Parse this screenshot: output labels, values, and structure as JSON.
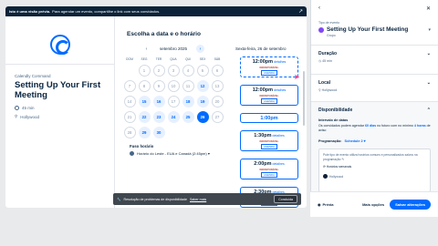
{
  "banner": {
    "bold": "Isto é uma visão prévia.",
    "text": "Para agendar um evento, compartilhe o link com seus convidados.",
    "icon": "external-link-icon"
  },
  "event": {
    "organizer": "Calendly Command",
    "title": "Setting Up Your First Meeting",
    "duration": "45 min",
    "location": "Hollywood"
  },
  "calendar": {
    "heading": "Escolha a data e o horário",
    "month": "setembro 2025",
    "dow": [
      "DOM",
      "SEG",
      "TER",
      "QUA",
      "QUI",
      "SEX",
      "SÁB"
    ],
    "weeks": [
      [
        {
          "d": "",
          "s": "blank"
        },
        {
          "d": "1",
          "s": ""
        },
        {
          "d": "2",
          "s": ""
        },
        {
          "d": "3",
          "s": ""
        },
        {
          "d": "4",
          "s": ""
        },
        {
          "d": "5",
          "s": ""
        },
        {
          "d": "6",
          "s": ""
        }
      ],
      [
        {
          "d": "7",
          "s": ""
        },
        {
          "d": "8",
          "s": ""
        },
        {
          "d": "9",
          "s": ""
        },
        {
          "d": "10",
          "s": ""
        },
        {
          "d": "11",
          "s": ""
        },
        {
          "d": "12",
          "s": "avail"
        },
        {
          "d": "13",
          "s": ""
        }
      ],
      [
        {
          "d": "14",
          "s": ""
        },
        {
          "d": "15",
          "s": "avail"
        },
        {
          "d": "16",
          "s": "avail"
        },
        {
          "d": "17",
          "s": ""
        },
        {
          "d": "18",
          "s": "avail"
        },
        {
          "d": "19",
          "s": "avail"
        },
        {
          "d": "20",
          "s": ""
        }
      ],
      [
        {
          "d": "21",
          "s": ""
        },
        {
          "d": "22",
          "s": "avail"
        },
        {
          "d": "23",
          "s": "avail"
        },
        {
          "d": "24",
          "s": "avail"
        },
        {
          "d": "25",
          "s": "avail"
        },
        {
          "d": "26",
          "s": "sel"
        },
        {
          "d": "27",
          "s": ""
        }
      ],
      [
        {
          "d": "28",
          "s": ""
        },
        {
          "d": "29",
          "s": "avail"
        },
        {
          "d": "30",
          "s": "avail"
        },
        {
          "d": "",
          "s": "blank"
        },
        {
          "d": "",
          "s": "blank"
        },
        {
          "d": "",
          "s": "blank"
        },
        {
          "d": "",
          "s": "blank"
        }
      ]
    ],
    "tz_label": "Fuso horário",
    "tz_value": "Horário do Leste - EUA e Canadá (2:45pm) ▾"
  },
  "times": {
    "date": "Sexta-feira, 26 de setembro",
    "slots": [
      {
        "time": "12:00pm",
        "detail": "detalhes",
        "flag": "INDISPONÍVEL",
        "badge": "AGENDA",
        "kind": "dashed"
      },
      {
        "time": "12:00pm",
        "detail": "detalhes",
        "flag": "INDISPONÍVEL",
        "badge": "AGENDA",
        "kind": ""
      },
      {
        "time": "1:00pm",
        "detail": "",
        "flag": "",
        "badge": "",
        "kind": "simple"
      },
      {
        "time": "1:30pm",
        "detail": "detalhes",
        "flag": "INDISPONÍVEL",
        "badge": "AGENDA",
        "kind": ""
      },
      {
        "time": "2:00pm",
        "detail": "detalhes",
        "flag": "INDISPONÍVEL",
        "badge": "AGENDA",
        "kind": ""
      },
      {
        "time": "2:30pm",
        "detail": "detalhes",
        "flag": "INDISPONÍVEL",
        "badge": "AGENDA",
        "kind": ""
      }
    ]
  },
  "notice": {
    "text": "Resolução de problemas de disponibilidade",
    "link": "Saber mais",
    "button": "Concluída"
  },
  "panel": {
    "type_label": "Tipo de evento",
    "name": "Setting Up Your First Meeting",
    "group": "Grupo",
    "duration_h": "Duração",
    "duration_v": "45 min",
    "location_h": "Local",
    "location_v": "Hollywood",
    "avail_h": "Disponibilidade",
    "interval_label": "Intervalo de datas",
    "interval_text_1": "Os convidados podem agendar ",
    "interval_days": "60 dias",
    "interval_text_2": " no futuro com no mínimo ",
    "interval_hours": "4 horas",
    "interval_text_3": " de aviso",
    "schedule_label": "Programação:",
    "schedule_value": "Schedule 2 ▾",
    "card_text": "Pule tipo de evento utiliza horários comuns e personalizados salvos na programação",
    "card_hours": "Horários semanais",
    "card_zone": "Hollywood",
    "preview": "Prévia",
    "more": "Mais opções",
    "save": "Salvar alterações"
  },
  "colors": {
    "accent": "#006bff",
    "dark": "#0b2238",
    "purple": "#8247f5"
  }
}
